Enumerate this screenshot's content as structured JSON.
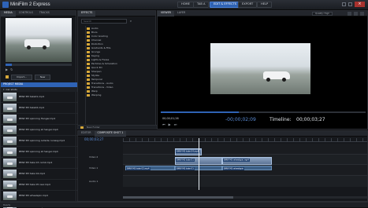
{
  "app": {
    "title": "MiniFilm 2 Express"
  },
  "nav": [
    {
      "label": "HOME"
    },
    {
      "label": "TAB A"
    },
    {
      "label": "EDIT & EFFECTS",
      "active": true
    },
    {
      "label": "EXPORT"
    },
    {
      "label": "HELP"
    }
  ],
  "library": {
    "tabs": [
      "MEDIA",
      "CONTROLS",
      "TRACKS"
    ],
    "preview_time": "",
    "import_label": "Import...",
    "new_label": "New",
    "project_media_label": "PROJECT MEDIA",
    "folder_label": "Car shots",
    "items": [
      {
        "name": "BMW M3 take01.mp4"
      },
      {
        "name": "BMW M3 take02.mp4"
      },
      {
        "name": "BMW M3 spinning Hangar.mp4"
      },
      {
        "name": "BMW M3 spinning at hangar.mp4"
      },
      {
        "name": "BMW M3 spinning outside runway.mp4"
      },
      {
        "name": "BMW M3 spinning at hangar.mp4"
      },
      {
        "name": "BMW M3 take 03 cam2.mp4"
      },
      {
        "name": "BMW M3 take 04.mp4"
      },
      {
        "name": "BMW M3 take 05 rear.mp4"
      },
      {
        "name": "BMW M3 wheelspin.mp4"
      },
      {
        "name": "BMW M3 take 06.mp4"
      }
    ]
  },
  "effects": {
    "tab": "EFFECTS",
    "tab2": "",
    "search_placeholder": "Search",
    "categories": [
      "Audio",
      "Blurs",
      "Color Grading",
      "Channel",
      "Distortion",
      "Gradients & Fills",
      "Grunge",
      "Keying",
      "Lights & Flares",
      "Particles & Simulation",
      "Quick 3D",
      "Sharpen",
      "Stylize",
      "Temporal",
      "Transitions - Audio",
      "Transitions - Video",
      "Warp",
      "Warping"
    ],
    "footer": "New Folder"
  },
  "viewer": {
    "tabs": [
      "VIEWER",
      "LAYER"
    ],
    "quality": "Quality: High",
    "timecode_left": "00;00;01;26",
    "timecode_main": "-00;00;02;09",
    "timeline_label": "Timeline:",
    "timeline_time": "00;00;03;27"
  },
  "editor": {
    "tabs": [
      "EDITOR",
      "COMPOSITE SHOT 1"
    ],
    "timecode": "00;00;03;27",
    "tracks": [
      {
        "label": "Video 2"
      },
      {
        "label": "Video 1"
      },
      {
        "label": "Audio 1"
      }
    ],
    "clips": [
      {
        "label": "BMW M3 take 04.mp4"
      },
      {
        "label": "BMW M3 take 01"
      },
      {
        "label": "BMW M3 wheelspin.mp4"
      },
      {
        "label": "BMW M3 take 02.mp4"
      },
      {
        "label": "BMW M3 take 01"
      },
      {
        "label": "BMW M3 wheelspin"
      }
    ]
  },
  "status": {
    "text": "Ready"
  },
  "colors": {
    "accent": "#2f63b5",
    "clip": "#5b7293",
    "folder": "#d8a93a",
    "timecode": "#5b8cd6"
  }
}
